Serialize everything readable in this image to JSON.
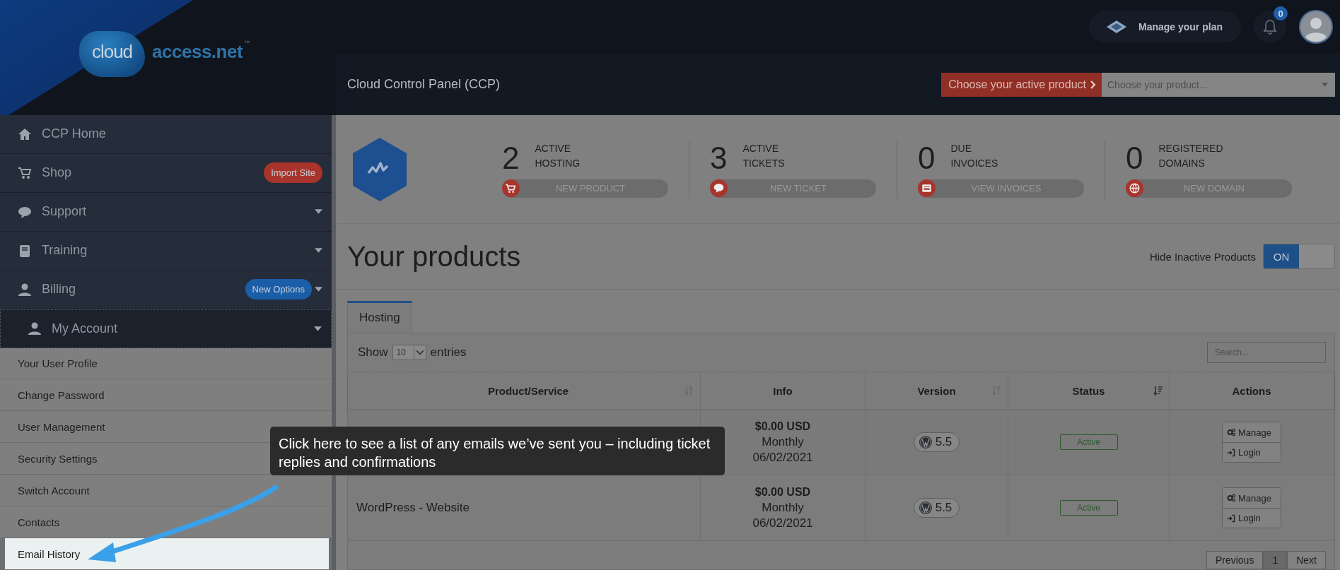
{
  "logo": {
    "word": "cloud",
    "name": "access.net",
    "mark": "™"
  },
  "top_bar": {
    "plan_button": "Manage your plan",
    "notification_count": "0"
  },
  "header": {
    "title": "Cloud Control Panel (CCP)",
    "product_label": "Choose your active product",
    "product_select": {
      "placeholder": "Choose your product..."
    }
  },
  "sidebar": {
    "items": [
      {
        "label": "CCP Home",
        "selected": false,
        "expandable": false
      },
      {
        "label": "Shop",
        "selected": false,
        "expandable": false,
        "badge": {
          "text": "Import Site",
          "color": "#a8342b"
        }
      },
      {
        "label": "Support",
        "selected": false,
        "expandable": true
      },
      {
        "label": "Training",
        "selected": false,
        "expandable": true
      },
      {
        "label": "Billing",
        "selected": false,
        "expandable": true,
        "badge": {
          "text": "New Options",
          "color": "#1a5ea8"
        }
      },
      {
        "label": "My Account",
        "selected": true,
        "expandable": true,
        "expanded": true,
        "children": [
          {
            "label": "Your User Profile",
            "selected": false
          },
          {
            "label": "Change Password",
            "selected": false
          },
          {
            "label": "User Management",
            "selected": false
          },
          {
            "label": "Security Settings",
            "selected": false
          },
          {
            "label": "Switch Account",
            "selected": false
          },
          {
            "label": "Contacts",
            "selected": false
          },
          {
            "label": "Email History",
            "selected": true
          }
        ]
      }
    ]
  },
  "stats": [
    {
      "value": "2",
      "label": "ACTIVE HOSTING",
      "button": "NEW PRODUCT"
    },
    {
      "value": "3",
      "label": "ACTIVE TICKETS",
      "button": "NEW TICKET"
    },
    {
      "value": "0",
      "label": "DUE INVOICES",
      "button": "VIEW INVOICES"
    },
    {
      "value": "0",
      "label": "REGISTERED DOMAINS",
      "button": "NEW DOMAIN"
    }
  ],
  "products": {
    "title": "Your products",
    "toggle": {
      "label": "Hide Inactive Products",
      "text": "ON",
      "on": true
    },
    "tabs": [
      {
        "label": "Hosting",
        "selected": true
      }
    ],
    "length": {
      "before": "Show",
      "value": "10",
      "after": "entries"
    },
    "search": {
      "placeholder": "Search..."
    },
    "table": {
      "columns": [
        {
          "label": "Product/Service",
          "sortable": true,
          "sorted": false
        },
        {
          "label": "Info",
          "sortable": false
        },
        {
          "label": "Version",
          "sortable": true,
          "sorted": false
        },
        {
          "label": "Status",
          "sortable": true,
          "sorted": true
        },
        {
          "label": "Actions",
          "sortable": false
        }
      ],
      "rows": [
        {
          "price": "$0.00 USD",
          "cycle": "Monthly",
          "date": "06/02/2021",
          "version": "5.5",
          "status": "Active",
          "actions": [
            "Manage",
            "Login"
          ]
        },
        {
          "product": "WordPress - Website",
          "price": "$0.00 USD",
          "cycle": "Monthly",
          "date": "06/02/2021",
          "version": "5.5",
          "status": "Active",
          "actions": [
            "Manage",
            "Login"
          ]
        }
      ]
    },
    "pagination": [
      {
        "label": "Previous",
        "selected": false
      },
      {
        "label": "1",
        "selected": true
      },
      {
        "label": "Next",
        "selected": false
      }
    ]
  },
  "tooltip": {
    "text": "Click here to see a list of any emails we’ve sent you – including ticket replies and confirmations"
  }
}
